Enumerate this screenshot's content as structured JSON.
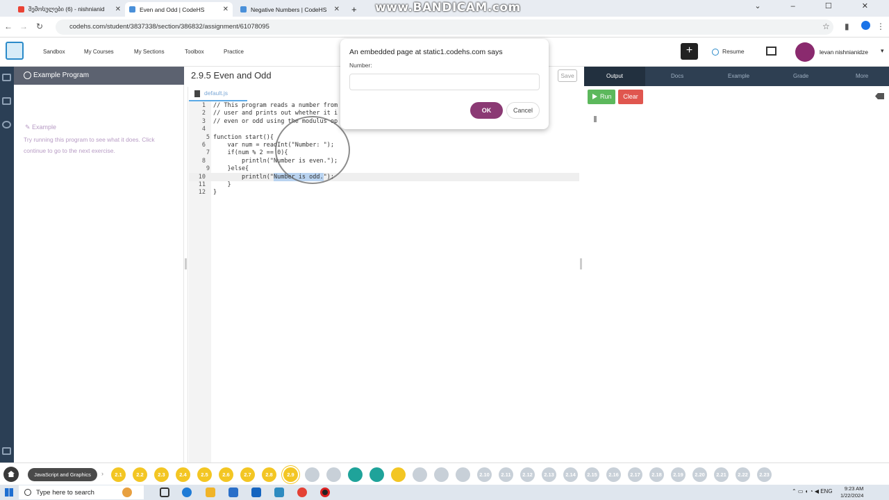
{
  "browser": {
    "tabs": [
      {
        "title": "შემოსულები (6) - nishnianid",
        "color": "#ea4335"
      },
      {
        "title": "Even and Odd | CodeHS",
        "color": "#4a90d9"
      },
      {
        "title": "Negative Numbers | CodeHS",
        "color": "#4a90d9"
      }
    ],
    "new_tab": "+",
    "watermark": "www.BANDICAM.com",
    "url": "codehs.com/student/3837338/section/386832/assignment/61078095"
  },
  "header": {
    "nav": [
      "Sandbox",
      "My Courses",
      "My Sections",
      "Toolbox",
      "Practice"
    ],
    "plus_label": "+",
    "resume_label": "Resume",
    "user_name": "levan nishnianidze"
  },
  "example_panel": {
    "title": "Example Program",
    "label": "Example",
    "description": "Try running this program to see what it does. Click continue to go to the next exercise."
  },
  "editor": {
    "title": "2.9.5 Even and Odd",
    "file_tab": "default.js",
    "save_label": "Save",
    "code_lines": [
      "// This program reads a number from",
      "// user and prints out whether it i",
      "// even or odd using the modulus op",
      "",
      "function start(){",
      "    var num = readInt(\"Number: \");",
      "    if(num % 2 == 0){",
      "        println(\"Number is even.\");",
      "    }else{",
      "        println(\"Number is odd.\");",
      "    }",
      "}"
    ],
    "line_numbers": [
      "1",
      "2",
      "3",
      "4",
      "5",
      "6",
      "7",
      "8",
      "9",
      "10",
      "11",
      "12"
    ]
  },
  "output_panel": {
    "tabs": [
      "Output",
      "Docs",
      "Example",
      "Grade",
      "More"
    ],
    "run_label": "Run",
    "clear_label": "Clear"
  },
  "dialog": {
    "title": "An embedded page at static1.codehs.com says",
    "prompt": "Number:",
    "input_value": "",
    "ok_label": "OK",
    "cancel_label": "Cancel"
  },
  "course_bar": {
    "course_name": "JavaScript and Graphics",
    "lessons": [
      {
        "label": "2.1",
        "color": "#f3c623"
      },
      {
        "label": "2.2",
        "color": "#f3c623"
      },
      {
        "label": "2.3",
        "color": "#f3c623"
      },
      {
        "label": "2.4",
        "color": "#f3c623"
      },
      {
        "label": "2.5",
        "color": "#f3c623"
      },
      {
        "label": "2.6",
        "color": "#f3c623"
      },
      {
        "label": "2.7",
        "color": "#f3c623"
      },
      {
        "label": "2.8",
        "color": "#f3c623"
      },
      {
        "label": "2.9",
        "color": "#f3c623"
      },
      {
        "label": "",
        "color": "#c8d0d8"
      },
      {
        "label": "",
        "color": "#c8d0d8"
      },
      {
        "label": "",
        "color": "#1fa39a"
      },
      {
        "label": "",
        "color": "#1fa39a"
      },
      {
        "label": "",
        "color": "#f3c623"
      },
      {
        "label": "",
        "color": "#c8d0d8"
      },
      {
        "label": "",
        "color": "#c8d0d8"
      },
      {
        "label": "",
        "color": "#c8d0d8"
      },
      {
        "label": "2.10",
        "color": "#c8d0d8"
      },
      {
        "label": "2.11",
        "color": "#c8d0d8"
      },
      {
        "label": "2.12",
        "color": "#c8d0d8"
      },
      {
        "label": "2.13",
        "color": "#c8d0d8"
      },
      {
        "label": "2.14",
        "color": "#c8d0d8"
      },
      {
        "label": "2.15",
        "color": "#c8d0d8"
      },
      {
        "label": "2.16",
        "color": "#c8d0d8"
      },
      {
        "label": "2.17",
        "color": "#c8d0d8"
      },
      {
        "label": "2.18",
        "color": "#c8d0d8"
      },
      {
        "label": "2.19",
        "color": "#c8d0d8"
      },
      {
        "label": "2.20",
        "color": "#c8d0d8"
      },
      {
        "label": "2.21",
        "color": "#c8d0d8"
      },
      {
        "label": "2.22",
        "color": "#c8d0d8"
      },
      {
        "label": "2.23",
        "color": "#c8d0d8"
      }
    ]
  },
  "taskbar": {
    "search_placeholder": "Type here to search",
    "language": "ENG",
    "time": "9:23 AM",
    "date": "1/22/2024"
  }
}
